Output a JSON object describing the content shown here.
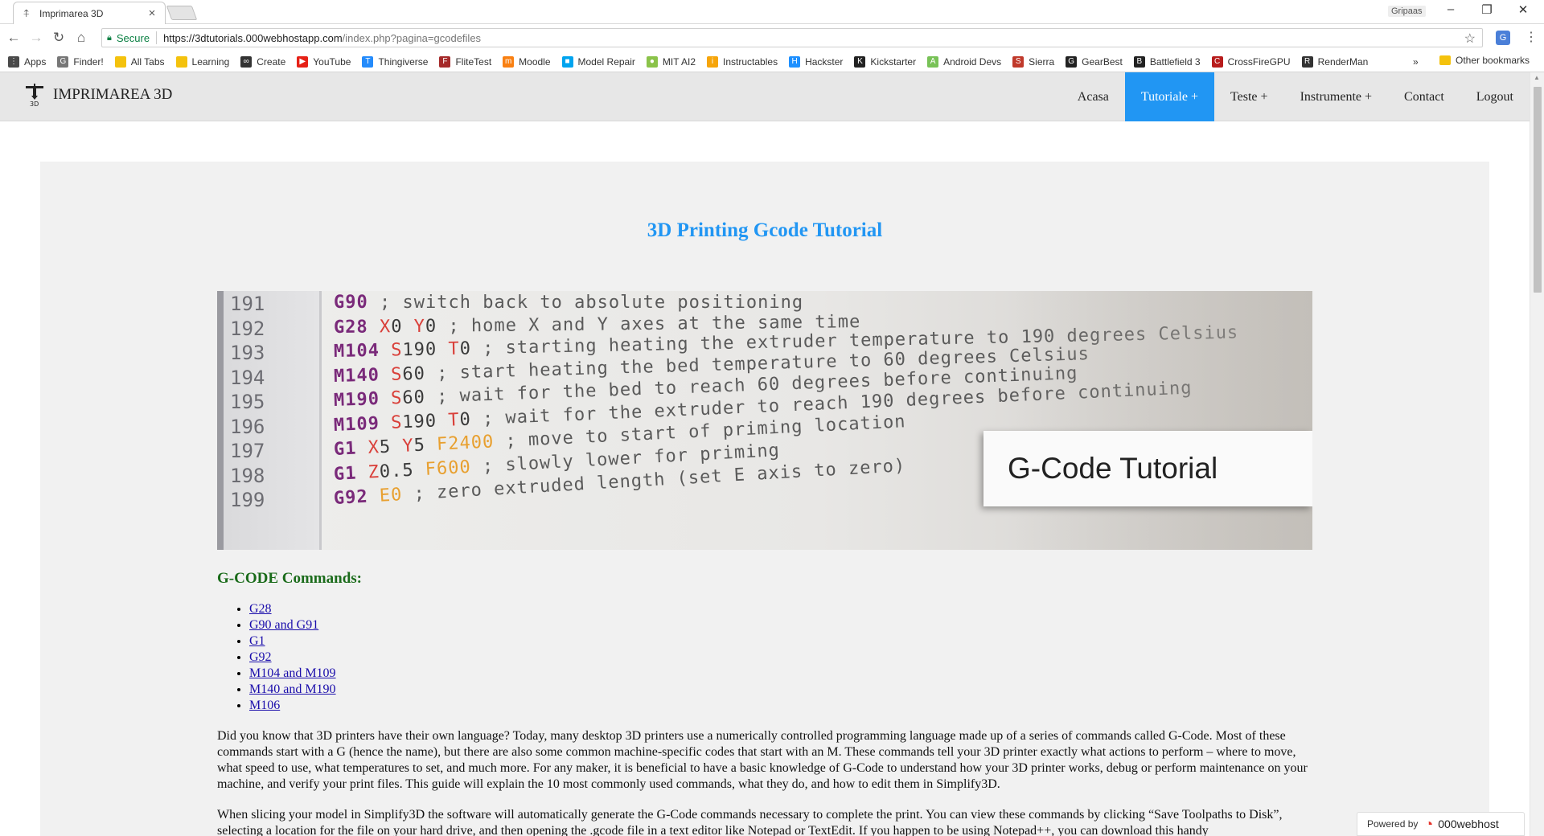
{
  "browser": {
    "tab_title": "Imprimarea 3D",
    "tab_close": "×",
    "profile_name": "Gripaas",
    "url_secure_label": "Secure",
    "url_host": "https://3dtutorials.000webhostapp.com",
    "url_path": "/index.php?pagina=gcodefiles",
    "window_controls": [
      "–",
      "❐",
      "✕"
    ],
    "bookmarks": [
      {
        "label": "Apps",
        "color": "#4a4a4a",
        "glyph": "⋮"
      },
      {
        "label": "Finder!",
        "color": "#777",
        "glyph": "G"
      },
      {
        "label": "All Tabs",
        "color": "#f4c20d",
        "glyph": ""
      },
      {
        "label": "Learning",
        "color": "#f4c20d",
        "glyph": ""
      },
      {
        "label": "Create",
        "color": "#333",
        "glyph": "∞"
      },
      {
        "label": "YouTube",
        "color": "#e62117",
        "glyph": "▶"
      },
      {
        "label": "Thingiverse",
        "color": "#248bfb",
        "glyph": "T"
      },
      {
        "label": "FliteTest",
        "color": "#a52a2a",
        "glyph": "F"
      },
      {
        "label": "Moodle",
        "color": "#f98012",
        "glyph": "m"
      },
      {
        "label": "Model Repair",
        "color": "#00a4ef",
        "glyph": "■"
      },
      {
        "label": "MIT AI2",
        "color": "#8bc34a",
        "glyph": "●"
      },
      {
        "label": "Instructables",
        "color": "#f6a50b",
        "glyph": "i"
      },
      {
        "label": "Hackster",
        "color": "#1e90ff",
        "glyph": "H"
      },
      {
        "label": "Kickstarter",
        "color": "#222",
        "glyph": "K"
      },
      {
        "label": "Android Devs",
        "color": "#78c257",
        "glyph": "A"
      },
      {
        "label": "Sierra",
        "color": "#c0392b",
        "glyph": "S"
      },
      {
        "label": "GearBest",
        "color": "#222",
        "glyph": "G"
      },
      {
        "label": "Battlefield 3",
        "color": "#222",
        "glyph": "B"
      },
      {
        "label": "CrossFireGPU",
        "color": "#b71c1c",
        "glyph": "C"
      },
      {
        "label": "RenderMan",
        "color": "#333",
        "glyph": "R"
      }
    ],
    "bookmarks_more": "»",
    "other_bookmarks": "Other bookmarks"
  },
  "site": {
    "brand": "IMPRIMAREA 3D",
    "nav": [
      {
        "label": "Acasa",
        "active": false
      },
      {
        "label": "Tutoriale +",
        "active": true
      },
      {
        "label": "Teste +",
        "active": false
      },
      {
        "label": "Instrumente +",
        "active": false
      },
      {
        "label": "Contact",
        "active": false
      },
      {
        "label": "Logout",
        "active": false
      }
    ],
    "accent_color": "#2196f3"
  },
  "main": {
    "title": "3D Printing Gcode Tutorial",
    "hero": {
      "card_text": "G-Code Tutorial",
      "lines": [
        {
          "no": "191",
          "tokens": [
            [
              "k",
              "G90"
            ],
            [
              "cmt",
              " ; switch back to absolute positioning"
            ]
          ]
        },
        {
          "no": "192",
          "tokens": [
            [
              "k",
              "G28"
            ],
            [
              "a",
              " X"
            ],
            [
              "n",
              "0"
            ],
            [
              "a",
              " Y"
            ],
            [
              "n",
              "0"
            ],
            [
              "cmt",
              " ; home X and Y axes at the same time"
            ]
          ]
        },
        {
          "no": "193",
          "tokens": [
            [
              "k",
              "M104"
            ],
            [
              "a",
              " S"
            ],
            [
              "n",
              "190"
            ],
            [
              "a",
              " T"
            ],
            [
              "n",
              "0"
            ],
            [
              "cmt",
              " ; starting heating the extruder temperature to 190 degrees Celsius"
            ]
          ]
        },
        {
          "no": "194",
          "tokens": [
            [
              "k",
              "M140"
            ],
            [
              "a",
              " S"
            ],
            [
              "n",
              "60"
            ],
            [
              "cmt",
              " ; start heating the bed temperature to 60 degrees Celsius"
            ]
          ]
        },
        {
          "no": "195",
          "tokens": [
            [
              "k",
              "M190"
            ],
            [
              "a",
              " S"
            ],
            [
              "n",
              "60"
            ],
            [
              "cmt",
              " ; wait for the bed to reach 60 degrees before continuing"
            ]
          ]
        },
        {
          "no": "196",
          "tokens": [
            [
              "k",
              "M109"
            ],
            [
              "a",
              " S"
            ],
            [
              "n",
              "190"
            ],
            [
              "a",
              " T"
            ],
            [
              "n",
              "0"
            ],
            [
              "cmt",
              " ; wait for the extruder to reach 190 degrees before continuing"
            ]
          ]
        },
        {
          "no": "197",
          "tokens": [
            [
              "k",
              "G1"
            ],
            [
              "a",
              " X"
            ],
            [
              "n",
              "5"
            ],
            [
              "a",
              " Y"
            ],
            [
              "n",
              "5"
            ],
            [
              "f",
              " F2400"
            ],
            [
              "cmt",
              " ; move to start of priming location"
            ]
          ]
        },
        {
          "no": "198",
          "tokens": [
            [
              "k",
              "G1"
            ],
            [
              "a",
              " Z"
            ],
            [
              "n",
              "0.5"
            ],
            [
              "f",
              " F600"
            ],
            [
              "cmt",
              " ; slowly lower for priming"
            ]
          ]
        },
        {
          "no": "199",
          "tokens": [
            [
              "k",
              "G92"
            ],
            [
              "f",
              " E0"
            ],
            [
              "cmt",
              " ; zero extruded length (set E axis to zero)"
            ]
          ]
        }
      ]
    },
    "commands_heading": "G-CODE Commands:",
    "commands": [
      "G28",
      "G90 and G91",
      "G1",
      "G92",
      "M104 and M109",
      "M140 and M190",
      "M106"
    ],
    "paragraph1": "Did you know that 3D printers have their own language? Today, many desktop 3D printers use a numerically controlled programming language made up of a series of commands called G-Code. Most of these commands start with a G (hence the name), but there are also some common machine-specific codes that start with an M. These commands tell your 3D printer exactly what actions to perform – where to move, what speed to use, what temperatures to set, and much more. For any maker, it is beneficial to have a basic knowledge of G-Code to understand how your 3D printer works, debug or perform maintenance on your machine, and verify your print files. This guide will explain the 10 most commonly used commands, what they do, and how to edit them in Simplify3D.",
    "paragraph2": "When slicing your model in Simplify3D the software will automatically generate the G-Code commands necessary to complete the print. You can view these commands by clicking “Save Toolpaths to Disk”, selecting a location for the file on your hard drive, and then opening the .gcode file in a text editor like Notepad or TextEdit. If you happen to be using Notepad++, you can download this handy"
  },
  "footer_badge": {
    "powered_label": "Powered by",
    "host_name": "000webhost"
  }
}
